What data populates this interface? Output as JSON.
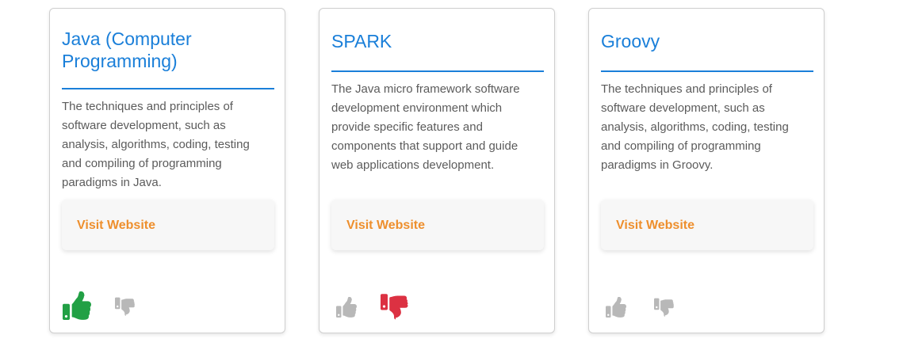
{
  "colors": {
    "title": "#1a7fd9",
    "link": "#ee8f2d",
    "text": "#5b5b5b",
    "like_active": "#22a045",
    "dislike_active": "#dc3142",
    "vote_inactive": "#b8b8b8"
  },
  "cards": [
    {
      "title": "Java (Computer Programming)",
      "description": "The techniques and principles of software development, such as analysis, algorithms, coding, testing and compiling of programming paradigms in Java.",
      "link_label": "Visit Website",
      "vote": "like",
      "icons": {
        "like": "thumbs-up-icon",
        "dislike": "thumbs-down-icon"
      }
    },
    {
      "title": "SPARK",
      "description": "The Java micro framework software development environment which provide specific features and components that support and guide web applications development.",
      "link_label": "Visit Website",
      "vote": "dislike",
      "icons": {
        "like": "thumbs-up-icon",
        "dislike": "thumbs-down-icon"
      }
    },
    {
      "title": "Groovy",
      "description": "The techniques and principles of software development, such as analysis, algorithms, coding, testing and compiling of programming paradigms in Groovy.",
      "link_label": "Visit Website",
      "vote": "none",
      "icons": {
        "like": "thumbs-up-icon",
        "dislike": "thumbs-down-icon"
      }
    }
  ]
}
